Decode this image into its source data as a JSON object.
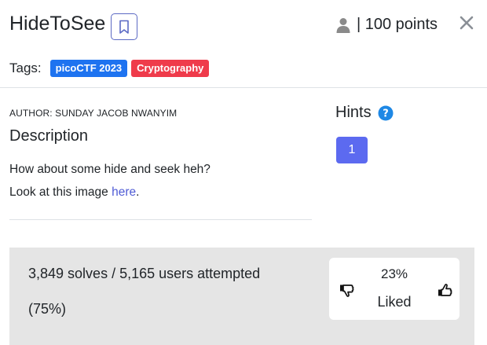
{
  "challenge": {
    "title": "HideToSee",
    "points_label": "| 100 points",
    "tags_label": "Tags:",
    "tags": [
      "picoCTF 2023",
      "Cryptography"
    ],
    "author": "AUTHOR: SUNDAY JACOB NWANYIM",
    "description_heading": "Description",
    "description_line1": "How about some hide and seek heh?",
    "description_line2_prefix": "Look at this image ",
    "description_link": "here",
    "description_line2_suffix": "."
  },
  "hints": {
    "heading": "Hints",
    "buttons": [
      "1"
    ]
  },
  "stats": {
    "solves_text": "3,849 solves / 5,165 users attempted",
    "percent_text": "(75%)",
    "liked_percent": "23%",
    "liked_label": "Liked"
  },
  "icons": {
    "bookmark": "bookmark-icon",
    "user": "user-icon",
    "close": "close-icon",
    "help": "question-circle-icon",
    "thumbs_down": "thumbs-down-icon",
    "thumbs_up": "thumbs-up-icon"
  },
  "colors": {
    "accent": "#5c6af0",
    "tag_blue": "#1e73f0",
    "tag_red": "#ef3b4b",
    "help_blue": "#1e88e5",
    "panel_bg": "#e5e5e5"
  }
}
